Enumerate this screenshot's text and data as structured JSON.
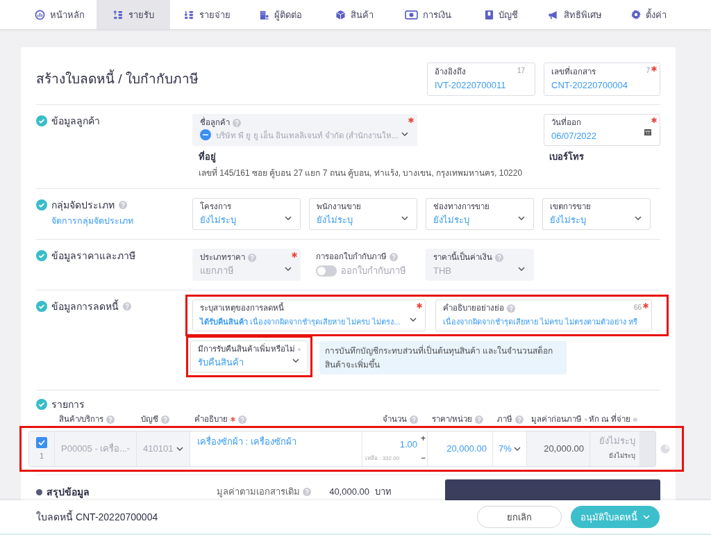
{
  "nav": [
    {
      "label": "หน้าหลัก",
      "selected": false
    },
    {
      "label": "รายรับ",
      "selected": true
    },
    {
      "label": "รายจ่าย",
      "selected": false
    },
    {
      "label": "ผู้ติดต่อ",
      "selected": false
    },
    {
      "label": "สินค้า",
      "selected": false
    },
    {
      "label": "การเงิน",
      "selected": false
    },
    {
      "label": "บัญชี",
      "selected": false
    },
    {
      "label": "สิทธิพิเศษ",
      "selected": false
    },
    {
      "label": "ตั้งค่า",
      "selected": false
    }
  ],
  "title": "สร้างใบลดหนี้ / ใบกำกับภาษี",
  "header_fields": [
    {
      "label": "อ้างอิงถึง",
      "counter": "17",
      "value": "IVT-20220700011",
      "required": false
    },
    {
      "label": "เลขที่เอกสาร",
      "counter": "7",
      "value": "CNT-20220700004",
      "required": true
    }
  ],
  "customer": {
    "title": "ข้อมูลลูกค้า",
    "name_field": {
      "label": "ชื่อลูกค้า",
      "help": true,
      "required": true,
      "disabled": true,
      "value": "บริษัท พี ยู ยู เอ็น อินเทลลิเจนท์ จำกัด (สำนักงานให..."
    },
    "date_field": {
      "label": "วันที่ออก",
      "required": true,
      "value": "06/07/2022"
    },
    "address_label": "ที่อยู่",
    "address": "เลขที่ 145/161 ซอย คู้บอน 27 แยก 7 ถนน คู้บอน, ท่าแร้ง, บางเขน, กรุงเทพมหานคร, 10220",
    "phone_label": "เบอร์โทร"
  },
  "classification": {
    "title": "กลุ่มจัดประเภท",
    "help": true,
    "link": "จัดการกลุ่มจัดประเภท",
    "fields": [
      {
        "label": "โครงการ",
        "help": false,
        "required": false,
        "disabled": false,
        "value": "ยังไม่ระบุ"
      },
      {
        "label": "พนักงานขาย",
        "help": false,
        "required": false,
        "disabled": false,
        "value": "ยังไม่ระบุ"
      },
      {
        "label": "ช่องทางการขาย",
        "help": false,
        "required": false,
        "disabled": false,
        "value": "ยังไม่ระบุ"
      },
      {
        "label": "เขตการขาย",
        "help": false,
        "required": false,
        "disabled": false,
        "value": "ยังไม่ระบุ"
      }
    ]
  },
  "pricing": {
    "title": "ข้อมูลราคาและภาษี",
    "price_type": {
      "label": "ประเภทราคา",
      "help": true,
      "required": true,
      "disabled": true,
      "value": "แยกภาษี"
    },
    "tax_invoice": {
      "label": "การออกใบกำกับภาษี",
      "help": true,
      "on": false,
      "text": "ออกใบกำกับภาษี"
    },
    "currency": {
      "label": "ราคานี้เป็นค่าเงิน",
      "help": true,
      "required": false,
      "disabled": true,
      "value": "THB"
    }
  },
  "credit": {
    "title": "ข้อมูลการลดหนี้",
    "help": true,
    "highlight_top": true,
    "highlight_return": true,
    "reason": {
      "label": "ระบุสาเหตุของการลดหนี้",
      "help": false,
      "required": true,
      "disabled": false,
      "value": "**ได้รับคืนสินค้า** เนื่องจากผิดจากชำรุดเสียหาย ไม่ครบ ไม่ตรง..."
    },
    "short_desc": {
      "label": "คำอธิบายอย่างย่อ",
      "help": true,
      "counter": "66",
      "required": true,
      "value": "เนื่องจากผิดจากชำรุดเสียหาย ไม่ครบ ไม่ตรงตามตัวอย่าง หรื"
    },
    "return_field": {
      "label": "มีการรับคืนสินค้าเพิ่มหรือไม่",
      "help": true,
      "required": false,
      "disabled": false,
      "value": "รับคืนสินค้า"
    },
    "note": "การบันทึกบัญชีกระทบส่วนที่เป็นต้นทุนสินค้า และในจำนวนสต็อก สินค้าจะเพิ่มขึ้น"
  },
  "items": {
    "title": "รายการ",
    "columns": [
      {
        "label": "สินค้า/บริการ",
        "help": true,
        "required": false
      },
      {
        "label": "บัญชี",
        "help": true,
        "required": false
      },
      {
        "label": "คำอธิบาย",
        "help": true,
        "required": true
      },
      {
        "label": "จำนวน",
        "help": true,
        "required": false
      },
      {
        "label": "ราคา/หน่วย",
        "help": true,
        "required": false
      },
      {
        "label": "ภาษี",
        "help": true,
        "required": false
      },
      {
        "label": "มูลค่าก่อนภาษี",
        "help": true,
        "required": false
      },
      {
        "label": "หัก ณ ที่จ่าย",
        "help": true,
        "required": false
      }
    ],
    "rows": [
      {
        "checked": true,
        "number": "1",
        "product": "P00005 - เครื่อ...",
        "account": "410101",
        "description": "เครื่องซักผ้า : เครื่องซักผ้า",
        "quantity": "1.00",
        "plus": "+",
        "minus": "−",
        "remaining": "เหลือ : 332.00",
        "price": "20,000.00",
        "tax": "7%",
        "pretax": "20,000.00",
        "withholding": "ยังไม่ระบุ",
        "withholding_note": "ยังไม่ระบุ",
        "highlighted": true
      }
    ]
  },
  "summary": {
    "title": "สรุปข้อมูล",
    "label": "มูลค่าตามเอกสารเดิม",
    "help": true,
    "value": "40,000.00",
    "unit": "บาท"
  },
  "footer": {
    "document": "ใบลดหนี้ CNT-20220700004",
    "cancel": "ยกเลิก",
    "approve": "อนุมัติใบลดหนี้"
  }
}
